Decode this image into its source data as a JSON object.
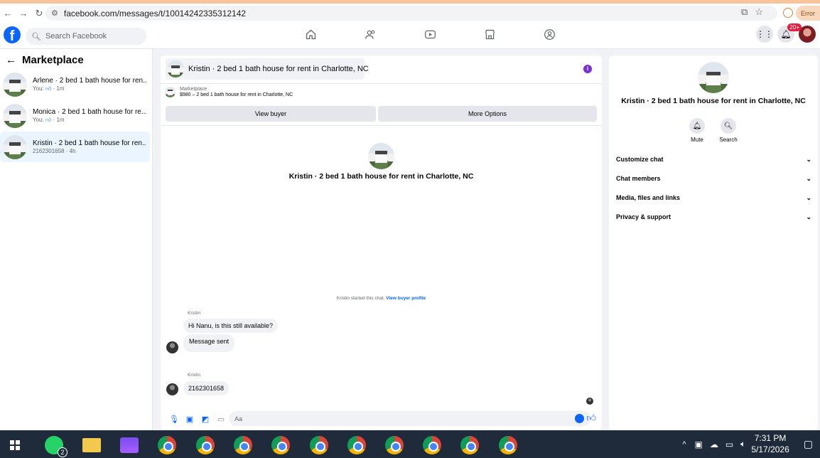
{
  "browser": {
    "url": "facebook.com/messages/t/10014242335312142",
    "error_label": "Error"
  },
  "facebook": {
    "logo": "f",
    "search_placeholder": "Search Facebook",
    "nav_icons": [
      "home-icon",
      "friends-icon",
      "watch-icon",
      "marketplace-icon",
      "groups-icon"
    ],
    "notification_badge": "20+"
  },
  "sidebar": {
    "title": "Marketplace",
    "conversations": [
      {
        "title": "Arlene · 2 bed 1 bath house for ren...",
        "sub_prefix": "You:",
        "sub_suffix": "· 1m"
      },
      {
        "title": "Monica · 2 bed 1 bath house for re...",
        "sub_prefix": "You:",
        "sub_suffix": "· 1m"
      },
      {
        "title": "Kristin · 2 bed 1 bath house for ren...",
        "sub_prefix": "2162301658 · 4h",
        "sub_suffix": ""
      }
    ]
  },
  "chat": {
    "header_title": "Kristin · 2 bed 1 bath house for rent in Charlotte, NC",
    "marketplace_label": "Marketplace",
    "listing": "$980 – 2 bed 1 bath house for rent in Charlotte, NC",
    "view_buyer": "View buyer",
    "more_options": "More Options",
    "center_title": "Kristin · 2 bed 1 bath house for rent in Charlotte, NC",
    "started_text": "Kristin started this chat.",
    "view_profile": "View buyer profile",
    "messages": [
      {
        "sender": "Kristin",
        "bubbles": [
          "Hi Nanu, is this still available?",
          "Message sent"
        ]
      },
      {
        "sender": "Kristin",
        "bubbles": [
          "2162301658"
        ]
      }
    ],
    "composer_placeholder": "Aa"
  },
  "details": {
    "title": "Kristin · 2 bed 1 bath house for rent in Charlotte, NC",
    "actions": [
      {
        "label": "Mute",
        "icon": "bell-icon"
      },
      {
        "label": "Search",
        "icon": "search-icon"
      }
    ],
    "sections": [
      "Customize chat",
      "Chat members",
      "Media, files and links",
      "Privacy & support"
    ]
  },
  "taskbar": {
    "whatsapp_badge": "2",
    "time": "7:31 PM",
    "date": "5/17/2026"
  }
}
